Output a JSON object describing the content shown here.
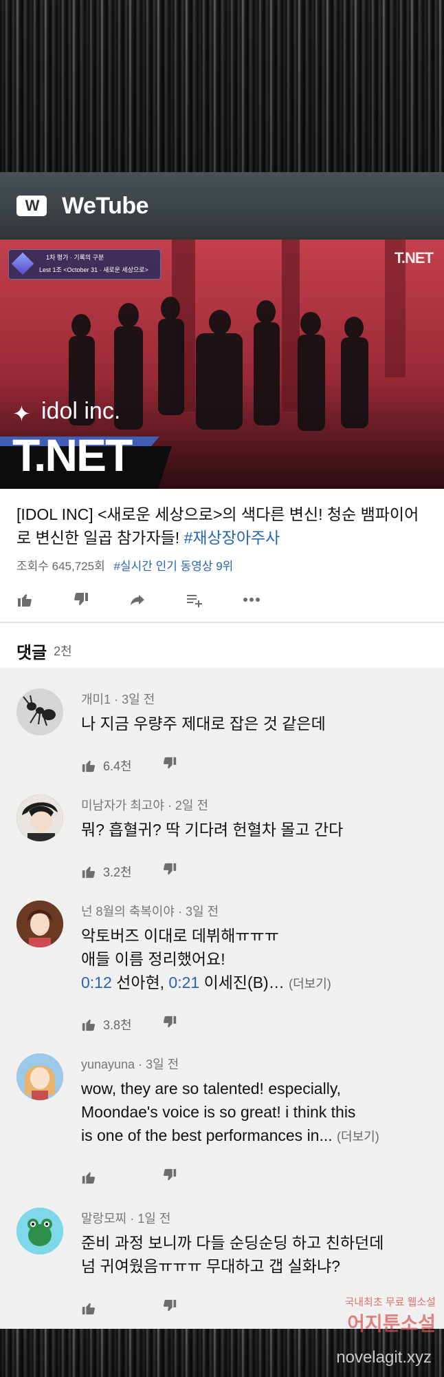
{
  "app": {
    "logo_text": "W",
    "title": "WeTube"
  },
  "video": {
    "badge_line1": "1차 평가 · 기록의 구분",
    "badge_line2": "Lest 1조 <October 31 · 새로운 세상으로>",
    "channel_watermark": "T.NET",
    "show_logo": "idol inc.",
    "network_logo": "T.NET"
  },
  "info": {
    "title": "[IDOL INC] <새로운 세상으로>의 색다른 변신! 청순 뱀파이어로 변신한 일곱 참가자들!",
    "hashtag": "#재상장아주사",
    "views": "조회수 645,725회",
    "trending": "#실시간 인기 동영상 9위"
  },
  "actions": {
    "like_icon": "thumbs-up-icon",
    "dislike_icon": "thumbs-down-icon",
    "share_icon": "share-icon",
    "save_icon": "playlist-add-icon",
    "more_icon": "more-icon"
  },
  "comments_header": {
    "title": "댓글",
    "count": "2천"
  },
  "comments": [
    {
      "author": "개미1",
      "time": "3일 전",
      "text": "나 지금 우량주 제대로 잡은 것 같은데",
      "likes": "6.4천",
      "avatar": "ant-avatar"
    },
    {
      "author": "미남자가 최고야",
      "time": "2일 전",
      "text": "뭐? 흡혈귀? 딱 기다려 헌혈차 몰고 간다",
      "likes": "3.2천",
      "avatar": "man-avatar"
    },
    {
      "author": "넌 8월의 축복이야",
      "time": "3일 전",
      "line1": "악토버즈 이대로 데뷔해ㅠㅠㅠ",
      "line2": "애들 이름 정리했어요!",
      "ts1": "0:12",
      "name1": " 선아현, ",
      "ts2": "0:21",
      "name2": " 이세진(B)…",
      "more": "(더보기)",
      "likes": "3.8천",
      "avatar": "girl-avatar"
    },
    {
      "author": "yunayuna",
      "time": "3일 전",
      "line1": "wow, they are so talented! especially,",
      "line2": "Moondae's voice is so great! i think this",
      "line3": "is one of the best performances in...",
      "more": "(더보기)",
      "likes": "",
      "avatar": "blonde-avatar"
    },
    {
      "author": "말랑모찌",
      "time": "1일 전",
      "line1": "준비 과정 보니까 다들 순딩순딩 하고 친하던데",
      "line2": "넘 귀여웠음ㅠㅠㅠ 무대하고 갭 실화냐?",
      "likes": "",
      "avatar": "frog-avatar"
    }
  ],
  "watermark": {
    "line1": "국내최초 무료 웹소설",
    "line2": "어지툰소설",
    "url": "novelagit.xyz"
  }
}
